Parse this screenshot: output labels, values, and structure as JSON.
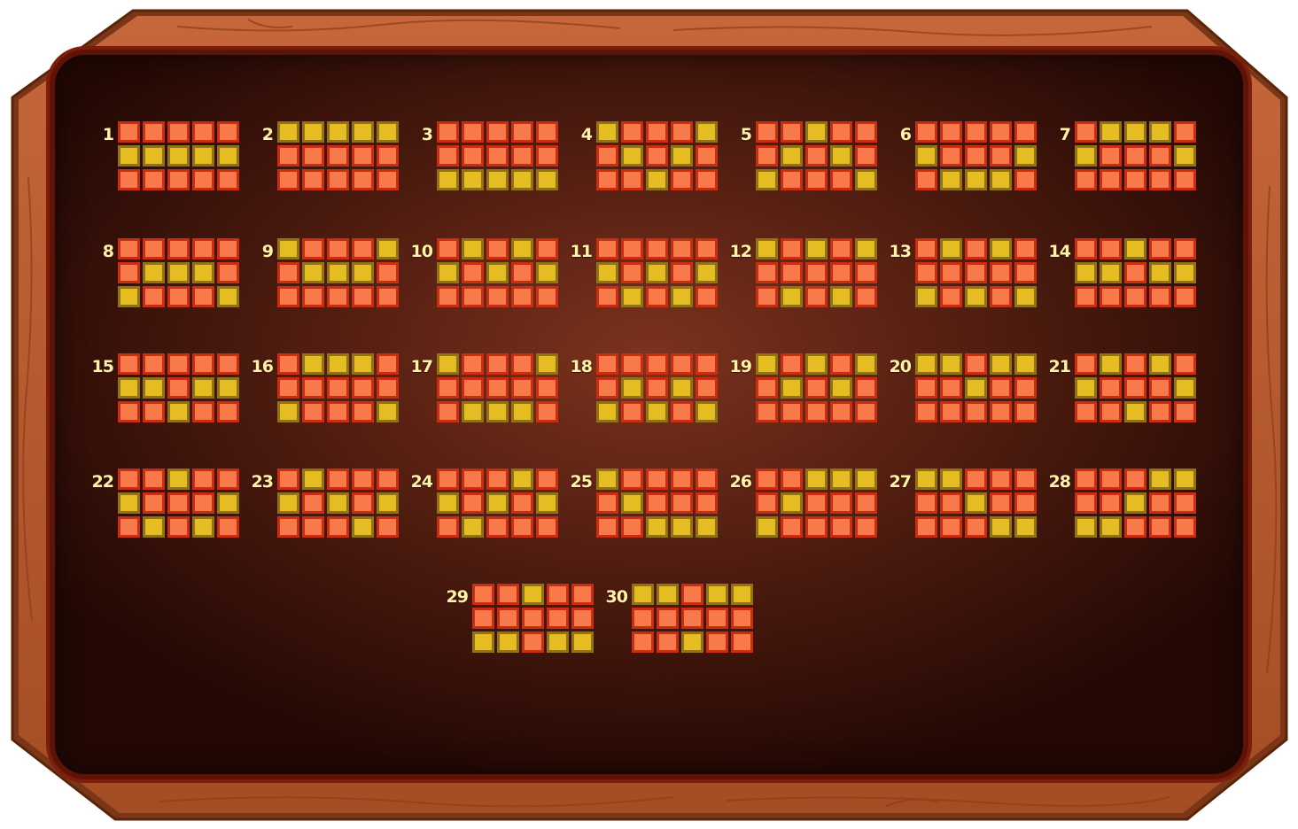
{
  "colors": {
    "cell_off_fill": "#f8794a",
    "cell_off_border": "#c92d12",
    "cell_on_fill": "#e5bd23",
    "cell_on_border": "#917316",
    "number_color": "#fff3a8",
    "board_center": "#7c321e",
    "board_edge": "#230804",
    "wood": "#b85c2e"
  },
  "paylines": [
    {
      "number": "1",
      "rows": [
        1,
        1,
        1,
        1,
        1
      ]
    },
    {
      "number": "2",
      "rows": [
        0,
        0,
        0,
        0,
        0
      ]
    },
    {
      "number": "3",
      "rows": [
        2,
        2,
        2,
        2,
        2
      ]
    },
    {
      "number": "4",
      "rows": [
        0,
        1,
        2,
        1,
        0
      ]
    },
    {
      "number": "5",
      "rows": [
        2,
        1,
        0,
        1,
        2
      ]
    },
    {
      "number": "6",
      "rows": [
        1,
        2,
        2,
        2,
        1
      ]
    },
    {
      "number": "7",
      "rows": [
        1,
        0,
        0,
        0,
        1
      ]
    },
    {
      "number": "8",
      "rows": [
        2,
        1,
        1,
        1,
        2
      ]
    },
    {
      "number": "9",
      "rows": [
        0,
        1,
        1,
        1,
        0
      ]
    },
    {
      "number": "10",
      "rows": [
        1,
        0,
        1,
        0,
        1
      ]
    },
    {
      "number": "11",
      "rows": [
        1,
        2,
        1,
        2,
        1
      ]
    },
    {
      "number": "12",
      "rows": [
        0,
        2,
        0,
        2,
        0
      ]
    },
    {
      "number": "13",
      "rows": [
        2,
        0,
        2,
        0,
        2
      ]
    },
    {
      "number": "14",
      "rows": [
        1,
        1,
        0,
        1,
        1
      ]
    },
    {
      "number": "15",
      "rows": [
        1,
        1,
        2,
        1,
        1
      ]
    },
    {
      "number": "16",
      "rows": [
        2,
        0,
        0,
        0,
        2
      ]
    },
    {
      "number": "17",
      "rows": [
        0,
        2,
        2,
        2,
        0
      ]
    },
    {
      "number": "18",
      "rows": [
        2,
        1,
        2,
        1,
        2
      ]
    },
    {
      "number": "19",
      "rows": [
        0,
        1,
        0,
        1,
        0
      ]
    },
    {
      "number": "20",
      "rows": [
        0,
        0,
        1,
        0,
        0
      ]
    },
    {
      "number": "21",
      "rows": [
        1,
        0,
        2,
        0,
        1
      ]
    },
    {
      "number": "22",
      "rows": [
        1,
        2,
        0,
        2,
        1
      ]
    },
    {
      "number": "23",
      "rows": [
        1,
        0,
        1,
        2,
        1
      ]
    },
    {
      "number": "24",
      "rows": [
        1,
        2,
        1,
        0,
        1
      ]
    },
    {
      "number": "25",
      "rows": [
        0,
        1,
        2,
        2,
        2
      ]
    },
    {
      "number": "26",
      "rows": [
        2,
        1,
        0,
        0,
        0
      ]
    },
    {
      "number": "27",
      "rows": [
        0,
        0,
        1,
        2,
        2
      ]
    },
    {
      "number": "28",
      "rows": [
        2,
        2,
        1,
        0,
        0
      ]
    },
    {
      "number": "29",
      "rows": [
        2,
        2,
        0,
        2,
        2
      ]
    },
    {
      "number": "30",
      "rows": [
        0,
        0,
        2,
        0,
        0
      ]
    }
  ]
}
